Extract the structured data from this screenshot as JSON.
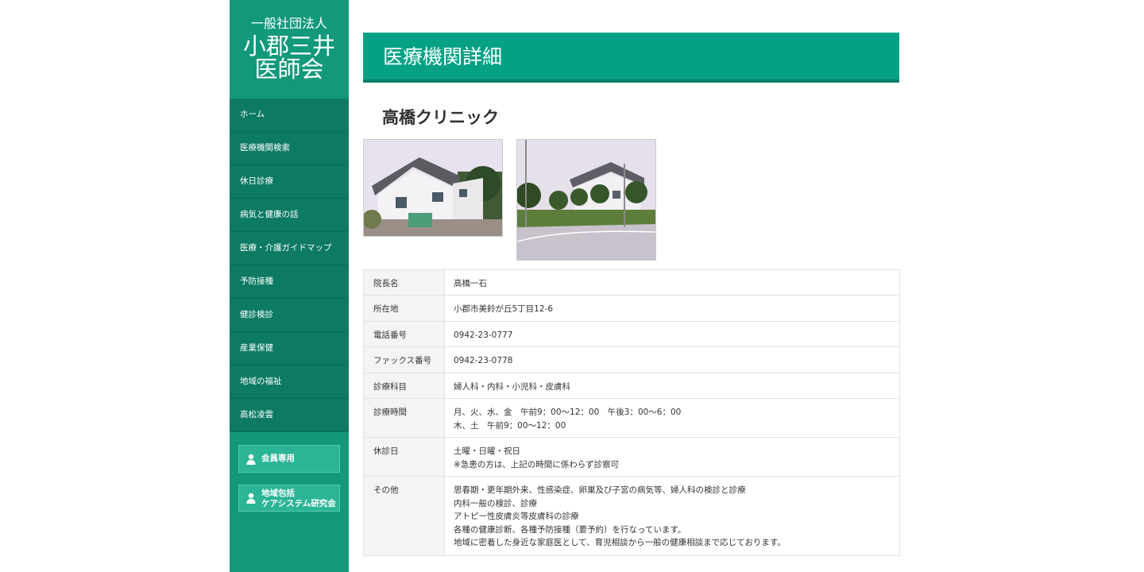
{
  "logo": {
    "org": "一般社団法人",
    "line1": "小郡三井",
    "line2": "医師会"
  },
  "nav": [
    "ホーム",
    "医療機関検索",
    "休日診療",
    "病気と健康の話",
    "医療・介護ガイドマップ",
    "予防接種",
    "健診検診",
    "産業保健",
    "地域の福祉",
    "高松凌雲"
  ],
  "side_buttons": {
    "member": "会員専用",
    "community_line1": "地域包括",
    "community_line2": "ケアシステム研究会"
  },
  "banner_title": "医療機関詳細",
  "clinic_name": "高橋クリニック",
  "details": {
    "director_label": "院長名",
    "director": "高橋一石",
    "address_label": "所在地",
    "address": "小郡市美鈴が丘5丁目12-6",
    "phone_label": "電話番号",
    "phone": "0942-23-0777",
    "fax_label": "ファックス番号",
    "fax": "0942-23-0778",
    "departments_label": "診療科目",
    "departments": "婦人科・内科・小児科・皮膚科",
    "hours_label": "診療時間",
    "hours_line1": "月、火、水、金　午前9：00〜12：00　午後3：00〜6：00",
    "hours_line2": "木、土　午前9：00〜12：00",
    "holiday_label": "休診日",
    "holiday_line1": "土曜・日曜・祝日",
    "holiday_line2": "※急患の方は、上記の時間に係わらず診察可",
    "other_label": "その他",
    "other_line1": "思春期・更年期外来、性感染症、卵巣及び子宮の病気等、婦人科の検診と診療",
    "other_line2": "内科一般の検診、診療",
    "other_line3": "アトピー性皮膚炎等皮膚科の診療",
    "other_line4": "各種の健康診断、各種予防接種（要予約）を行なっています。",
    "other_line5": "地域に密着した身近な家庭医として、育児相談から一般の健康相談まで応じております。"
  },
  "colors": {
    "accent": "#06a185",
    "sidebar": "#12997c",
    "nav": "#0d7a63",
    "button": "#2bb596"
  }
}
